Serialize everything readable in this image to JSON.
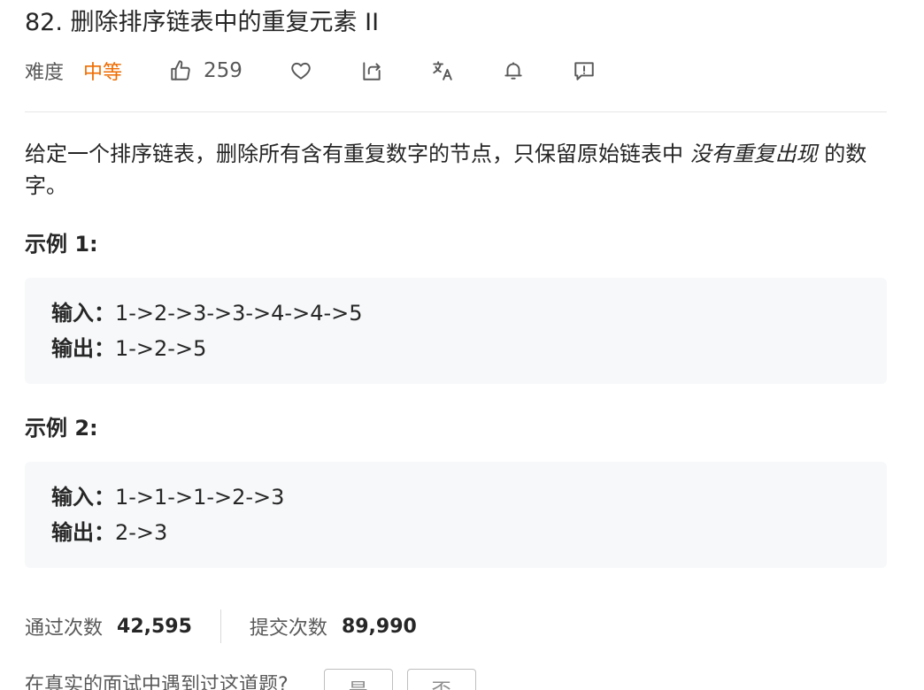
{
  "problem": {
    "title": "82. 删除排序链表中的重复元素 II",
    "difficulty_label": "难度",
    "difficulty": "中等",
    "like_count": "259",
    "accent_color": "#ef6c00"
  },
  "icons": {
    "like": "thumbs-up-icon",
    "favorite": "heart-icon",
    "share": "share-icon",
    "translate": "translate-icon",
    "notify": "bell-icon",
    "feedback": "feedback-icon"
  },
  "description": {
    "text_before": "给定一个排序链表，删除所有含有重复数字的节点，只保留原始链表中 ",
    "emphasis": "没有重复出现",
    "text_after": " 的数字。"
  },
  "examples": [
    {
      "title": "示例 1:",
      "input_label": "输入：",
      "input": "1->2->3->3->4->4->5",
      "output_label": "输出：",
      "output": "1->2->5"
    },
    {
      "title": "示例 2:",
      "input_label": "输入：",
      "input": "1->1->1->2->3",
      "output_label": "输出：",
      "output": "2->3"
    }
  ],
  "stats": {
    "accepted_label": "通过次数",
    "accepted": "42,595",
    "submitted_label": "提交次数",
    "submitted": "89,990"
  },
  "feedback": {
    "question": "在真实的面试中遇到过这道题?",
    "yes": "是",
    "no": "否"
  }
}
